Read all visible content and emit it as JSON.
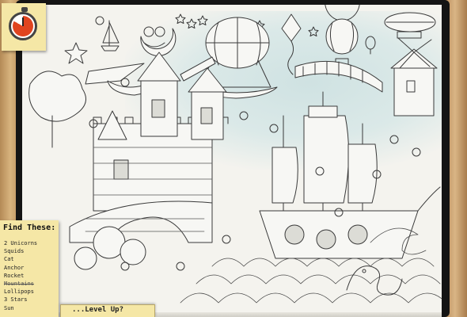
{
  "find_list": {
    "title": "Find These:",
    "items": [
      {
        "label": "2 Unicorns",
        "found": false
      },
      {
        "label": "Squids",
        "found": false
      },
      {
        "label": "Cat",
        "found": false
      },
      {
        "label": "Anchor",
        "found": false
      },
      {
        "label": "Rocket",
        "found": false
      },
      {
        "label": "Mountains",
        "found": true
      },
      {
        "label": "Lollipops",
        "found": false
      },
      {
        "label": "3 Stars",
        "found": false
      },
      {
        "label": "Sun",
        "found": false
      }
    ]
  },
  "bottom_tab": {
    "label": "...Level Up?"
  },
  "timer": {
    "icon": "stopwatch-icon",
    "elapsed_fraction": 0.83,
    "accent_color": "#e0441f"
  },
  "colors": {
    "note": "#f5e7a6",
    "frame": "#141414",
    "page": "#f4f3ee"
  }
}
